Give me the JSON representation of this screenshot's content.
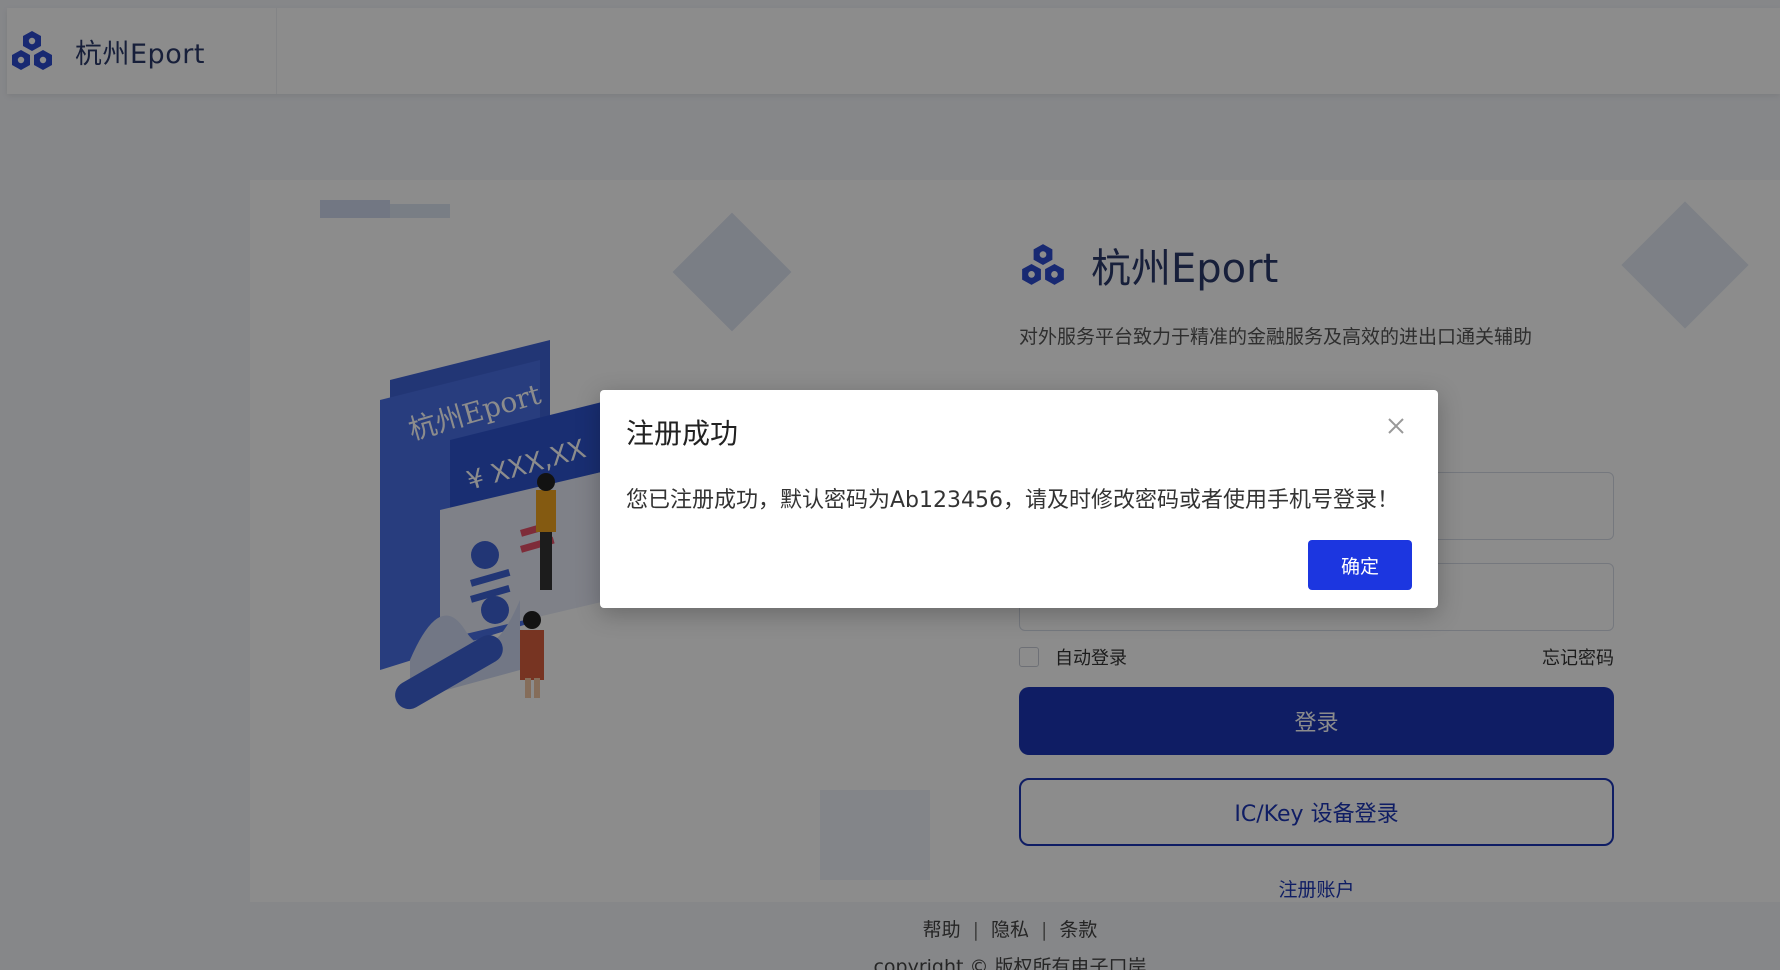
{
  "app": {
    "title": "杭州Eport"
  },
  "login": {
    "title": "杭州Eport",
    "slogan": "对外服务平台致力于精准的金融服务及高效的进出口通关辅助",
    "remember_label": "自动登录",
    "forgot_label": "忘记密码",
    "login_button": "登录",
    "ickey_button": "IC/Key 设备登录",
    "register_link": "注册账户"
  },
  "illustration": {
    "brand_text": "杭州Eport",
    "price_text": "¥ XXX,XX"
  },
  "footer": {
    "links": [
      "帮助",
      "隐私",
      "条款"
    ],
    "copyright": "copyright © 版权所有电子口岸"
  },
  "modal": {
    "title": "注册成功",
    "message": "您已注册成功，默认密码为Ab123456，请及时修改密码或者使用手机号登录！",
    "ok_button": "确定"
  },
  "colors": {
    "primary": "#1c36b6",
    "modal_button": "#1c36e0",
    "brand_text": "#2b3a6b"
  },
  "icons": {
    "logo": "cube-cluster-icon",
    "close": "close-icon"
  }
}
